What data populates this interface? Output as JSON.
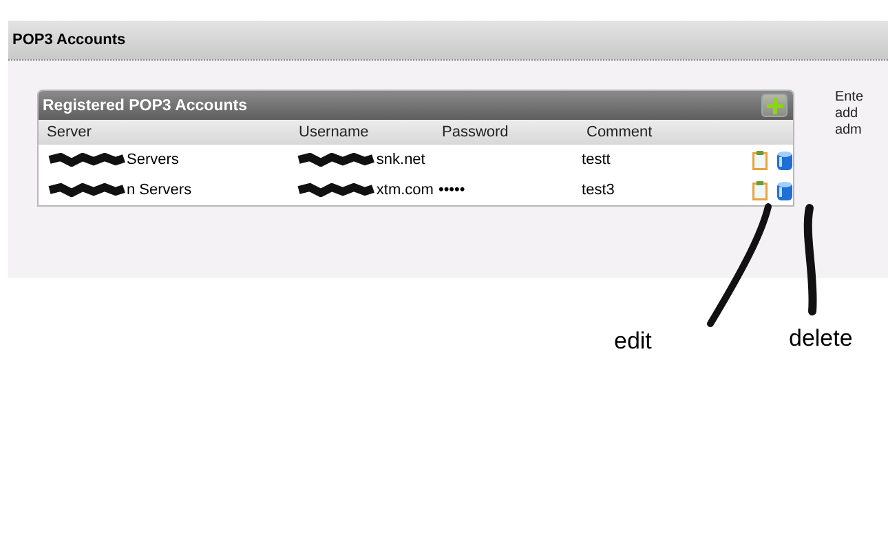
{
  "panel": {
    "title": "POP3 Accounts"
  },
  "accounts_box": {
    "title": "Registered POP3 Accounts",
    "columns": [
      "Server",
      "Username",
      "Password",
      "Comment"
    ],
    "rows": [
      {
        "redacted": true,
        "server": "Servers",
        "username": "snk.net",
        "comment": "testt"
      },
      {
        "redacted": true,
        "server": "n Servers",
        "username": "xtm.com",
        "password": "•••••",
        "comment": "test3"
      }
    ]
  },
  "side_note": [
    "Ente",
    "add",
    "adm"
  ],
  "annotations": [
    {
      "text": "edit"
    },
    {
      "text": "delete"
    }
  ]
}
